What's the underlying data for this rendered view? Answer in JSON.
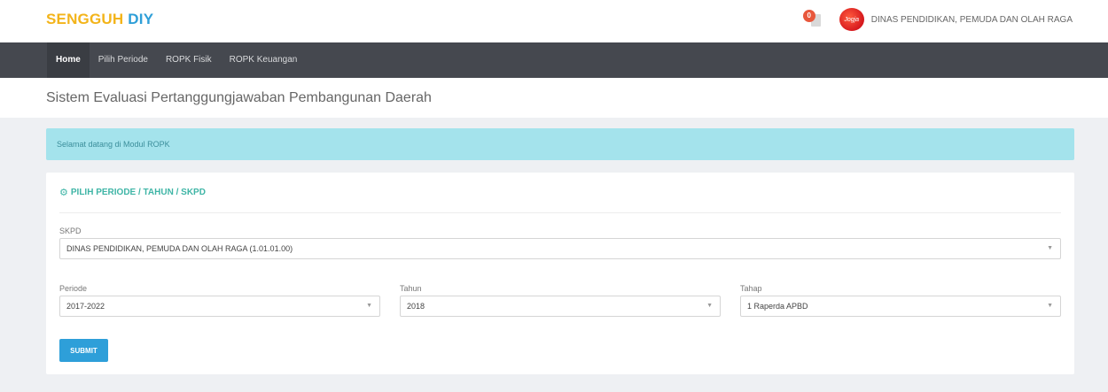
{
  "brand": {
    "part1": "SENGGUH",
    "part2": "DIY"
  },
  "header": {
    "notification_count": "0",
    "avatar_text": "Jogja",
    "user_name": "DINAS PENDIDIKAN, PEMUDA DAN OLAH RAGA"
  },
  "nav": {
    "items": [
      {
        "label": "Home",
        "active": true
      },
      {
        "label": "Pilih Periode"
      },
      {
        "label": "ROPK Fisik"
      },
      {
        "label": "ROPK Keuangan"
      }
    ]
  },
  "page": {
    "title": "Sistem Evaluasi Pertanggungjawaban Pembangunan Daerah"
  },
  "alert": {
    "text": "Selamat datang di Modul ROPK"
  },
  "panel": {
    "title": "PILIH PERIODE / TAHUN / SKPD",
    "skpd": {
      "label": "SKPD",
      "value": "DINAS PENDIDIKAN, PEMUDA DAN OLAH RAGA (1.01.01.00)"
    },
    "periode": {
      "label": "Periode",
      "value": "2017-2022"
    },
    "tahun": {
      "label": "Tahun",
      "value": "2018"
    },
    "tahap": {
      "label": "Tahap",
      "value": "1 Raperda APBD"
    },
    "submit_label": "SUBMIT"
  },
  "colors": {
    "brand_yellow": "#f3b41a",
    "brand_blue": "#2f9fd8",
    "navbar": "#45484f",
    "alert_bg": "#a4e3ec",
    "panel_title": "#3fb5a6",
    "button": "#2e9fd9"
  },
  "icons": {
    "notification": "bell-document-icon",
    "panel_title": "gear-icon",
    "select_caret": "chevron-down-icon"
  }
}
